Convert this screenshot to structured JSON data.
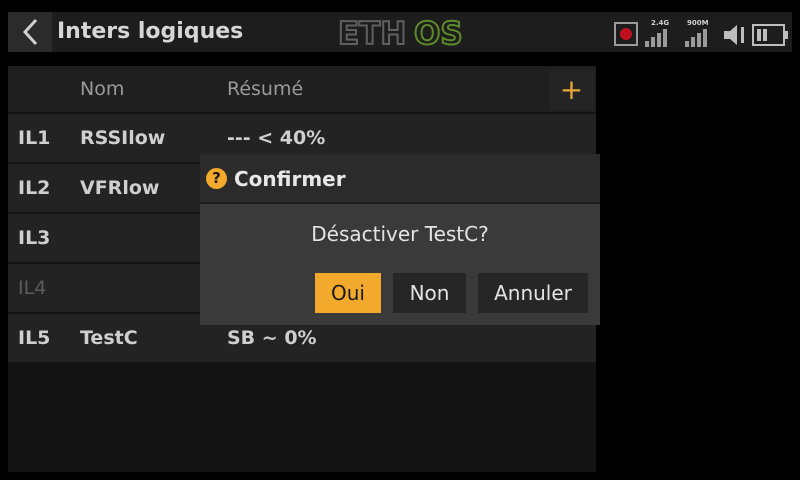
{
  "header": {
    "title": "Inters logiques",
    "logo": {
      "left": "ETH",
      "right": "OS"
    },
    "status": {
      "rf_2g4": "2.4G",
      "rf_900m": "900M"
    }
  },
  "table": {
    "columns": {
      "name": "Nom",
      "summary": "Résumé"
    },
    "add_label": "+",
    "rows": [
      {
        "id": "IL1",
        "name": "RSSIlow",
        "summary": "--- < 40%",
        "enabled": true
      },
      {
        "id": "IL2",
        "name": "VFRlow",
        "summary": "",
        "enabled": true
      },
      {
        "id": "IL3",
        "name": "",
        "summary": "",
        "enabled": true
      },
      {
        "id": "IL4",
        "name": "",
        "summary": "",
        "enabled": false
      },
      {
        "id": "IL5",
        "name": "TestC",
        "summary": "SB ~ 0%",
        "enabled": true
      }
    ]
  },
  "dialog": {
    "title": "Confirmer",
    "message": "Désactiver TestC?",
    "buttons": {
      "yes": "Oui",
      "no": "Non",
      "cancel": "Annuler"
    }
  },
  "colors": {
    "accent": "#f3a92b",
    "logo_green": "#5d8a2a",
    "record": "#c0101f"
  }
}
